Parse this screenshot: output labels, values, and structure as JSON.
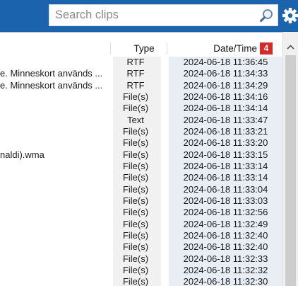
{
  "search": {
    "placeholder": "Search clips",
    "value": ""
  },
  "icons": {
    "search": "search-icon",
    "gear": "gear-icon",
    "scroll_up": "chevron-up-icon"
  },
  "colors": {
    "toolbar": "#1b63ad",
    "badge": "#d32a2a",
    "date_column": "#e9edf4"
  },
  "table": {
    "headers": {
      "name": "",
      "type": "Type",
      "date": "Date/Time"
    },
    "badge": "4",
    "rows": [
      {
        "name": "",
        "type": "RTF",
        "date": "2024-06-18 11:36:45"
      },
      {
        "name": "e. Minneskort används ...",
        "type": "RTF",
        "date": "2024-06-18 11:34:33"
      },
      {
        "name": "e. Minneskort används ...",
        "type": "RTF",
        "date": "2024-06-18 11:34:29"
      },
      {
        "name": "",
        "type": "File(s)",
        "date": "2024-06-18 11:34:16"
      },
      {
        "name": "",
        "type": "File(s)",
        "date": "2024-06-18 11:34:14"
      },
      {
        "name": "",
        "type": "Text",
        "date": "2024-06-18 11:33:47"
      },
      {
        "name": "",
        "type": "File(s)",
        "date": "2024-06-18 11:33:21"
      },
      {
        "name": "",
        "type": "File(s)",
        "date": "2024-06-18 11:33:20"
      },
      {
        "name": "naldi).wma",
        "type": "File(s)",
        "date": "2024-06-18 11:33:15"
      },
      {
        "name": "",
        "type": "File(s)",
        "date": "2024-06-18 11:33:14"
      },
      {
        "name": "",
        "type": "File(s)",
        "date": "2024-06-18 11:33:14"
      },
      {
        "name": "",
        "type": "File(s)",
        "date": "2024-06-18 11:33:04"
      },
      {
        "name": "",
        "type": "File(s)",
        "date": "2024-06-18 11:33:03"
      },
      {
        "name": "",
        "type": "File(s)",
        "date": "2024-06-18 11:32:56"
      },
      {
        "name": "",
        "type": "File(s)",
        "date": "2024-06-18 11:32:49"
      },
      {
        "name": "",
        "type": "File(s)",
        "date": "2024-06-18 11:32:40"
      },
      {
        "name": "",
        "type": "File(s)",
        "date": "2024-06-18 11:32:40"
      },
      {
        "name": "",
        "type": "File(s)",
        "date": "2024-06-18 11:32:33"
      },
      {
        "name": "",
        "type": "File(s)",
        "date": "2024-06-18 11:32:32"
      },
      {
        "name": "",
        "type": "File(s)",
        "date": "2024-06-18 11:32:30"
      }
    ]
  }
}
